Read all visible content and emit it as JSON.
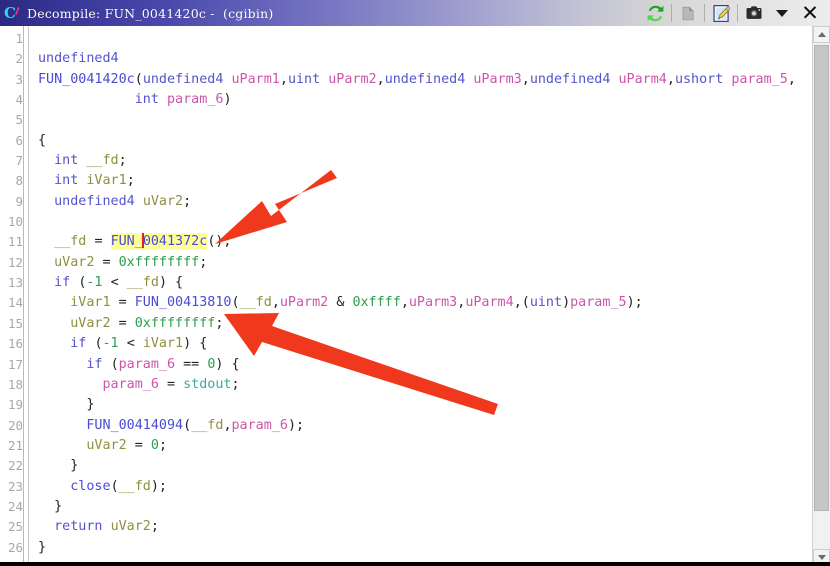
{
  "window": {
    "title": "Decompile: FUN_0041420c -  (cgibin)",
    "app_icon_name": "ghidra-dragon-icon"
  },
  "toolbar": {
    "refresh_label": "Refresh decompilation",
    "snapshot_disabled_label": "Copy",
    "edit_label": "Edit function signature",
    "camera_label": "Snapshot",
    "menu_label": "Menu",
    "close_label": "Close"
  },
  "scrollbar": {
    "up_label": "Scroll up",
    "down_label": "Scroll down",
    "thumb_label": "Scroll thumb"
  },
  "editor": {
    "highlight_color": "#ffff99",
    "caret_color": "#e02020",
    "line_numbers": [
      1,
      2,
      3,
      4,
      5,
      6,
      7,
      8,
      9,
      10,
      11,
      12,
      13,
      14,
      15,
      16,
      17,
      18,
      19,
      20,
      21,
      22,
      23,
      24,
      25,
      26
    ],
    "lines": [
      {
        "n": 1,
        "text": ""
      },
      {
        "n": 2,
        "text": "undefined4"
      },
      {
        "n": 3,
        "text": "FUN_0041420c(undefined4 uParm1,uint uParm2,undefined4 uParm3,undefined4 uParm4,ushort param_5,"
      },
      {
        "n": 4,
        "text": "            int param_6)"
      },
      {
        "n": 5,
        "text": ""
      },
      {
        "n": 6,
        "text": "{"
      },
      {
        "n": 7,
        "text": "  int __fd;"
      },
      {
        "n": 8,
        "text": "  int iVar1;"
      },
      {
        "n": 9,
        "text": "  undefined4 uVar2;"
      },
      {
        "n": 10,
        "text": ""
      },
      {
        "n": 11,
        "text": "  __fd = FUN_0041372c();"
      },
      {
        "n": 12,
        "text": "  uVar2 = 0xffffffff;"
      },
      {
        "n": 13,
        "text": "  if (-1 < __fd) {"
      },
      {
        "n": 14,
        "text": "    iVar1 = FUN_00413810(__fd,uParm2 & 0xffff,uParm3,uParm4,(uint)param_5);"
      },
      {
        "n": 15,
        "text": "    uVar2 = 0xffffffff;"
      },
      {
        "n": 16,
        "text": "    if (-1 < iVar1) {"
      },
      {
        "n": 17,
        "text": "      if (param_6 == 0) {"
      },
      {
        "n": 18,
        "text": "        param_6 = stdout;"
      },
      {
        "n": 19,
        "text": "      }"
      },
      {
        "n": 20,
        "text": "      FUN_00414094(__fd,param_6);"
      },
      {
        "n": 21,
        "text": "      uVar2 = 0;"
      },
      {
        "n": 22,
        "text": "    }"
      },
      {
        "n": 23,
        "text": "    close(__fd);"
      },
      {
        "n": 24,
        "text": "  }"
      },
      {
        "n": 25,
        "text": "  return uVar2;"
      },
      {
        "n": 26,
        "text": "}"
      }
    ],
    "highlighted_token": "FUN_0041372c",
    "highlighted_line": 11
  },
  "annotations": {
    "arrow_color": "#f0381c",
    "arrows": [
      {
        "name": "arrow-to-highlighted-call",
        "points_to": "FUN_0041372c",
        "line": 11
      },
      {
        "name": "arrow-to-call-arguments",
        "points_to": "FUN_00413810",
        "line": 14
      }
    ]
  },
  "tokens": {
    "t3": [
      "FUN_0041420c",
      "undefined4",
      "uParm1",
      "uint",
      "uParm2",
      "uParm3",
      "uParm4",
      "ushort",
      "param_5"
    ],
    "t11": [
      "__fd",
      "FUN_0041372c"
    ],
    "t14": [
      "iVar1",
      "FUN_00413810",
      "__fd",
      "uParm2",
      "0xffff",
      "uParm3",
      "uParm4",
      "uint",
      "param_5"
    ],
    "t18": [
      "param_6",
      "stdout"
    ],
    "t20": [
      "FUN_00414094",
      "__fd",
      "param_6"
    ],
    "t23": [
      "close",
      "__fd"
    ],
    "t25": [
      "return",
      "uVar2"
    ]
  }
}
